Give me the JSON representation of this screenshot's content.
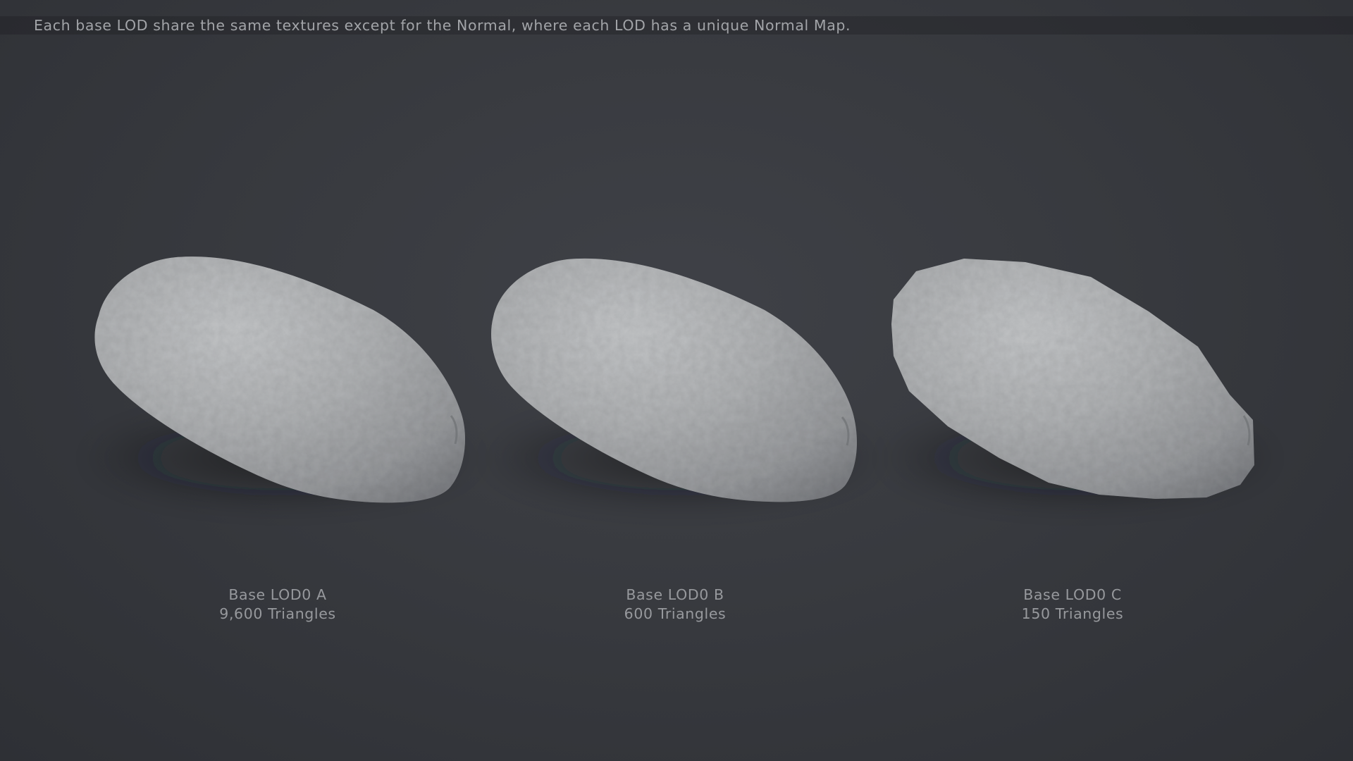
{
  "header": {
    "text": "Each base LOD share the same textures except for the Normal, where each LOD has a unique Normal Map."
  },
  "colors": {
    "background": "#383a3f",
    "model_surface": "#a4a6a8",
    "caption_text": "#97999d"
  },
  "models": [
    {
      "name": "Base LOD0 A",
      "triangles": "9,600 Triangles"
    },
    {
      "name": "Base LOD0 B",
      "triangles": "600 Triangles"
    },
    {
      "name": "Base LOD0 C",
      "triangles": "150 Triangles"
    }
  ]
}
